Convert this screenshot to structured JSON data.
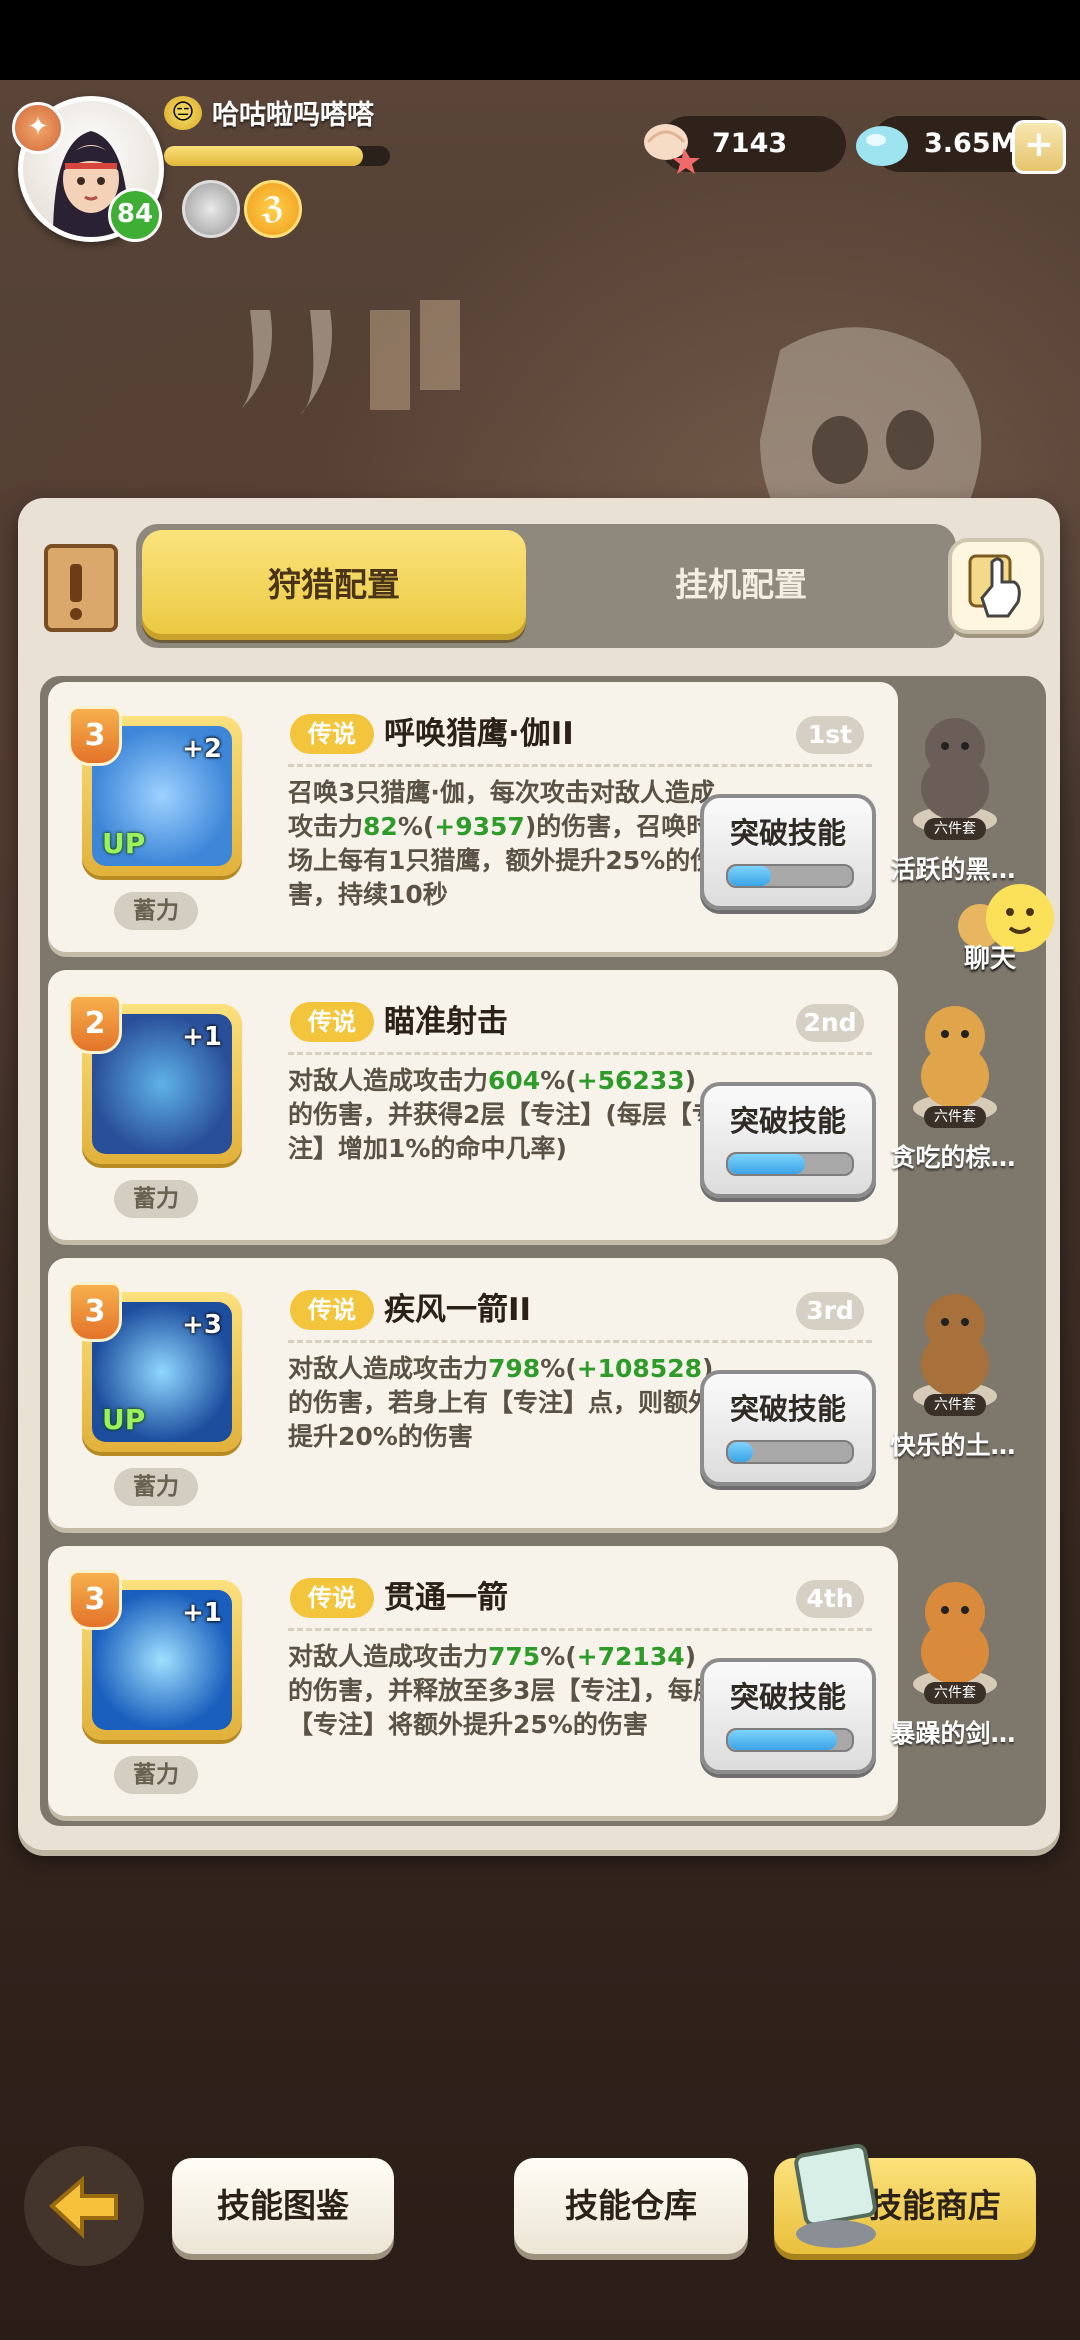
{
  "player": {
    "name": "哈咕啦吗嗒嗒",
    "level": "84",
    "xp_fraction": 0.88
  },
  "currencies": {
    "shells": "7143",
    "crystals": "3.65M",
    "plus": "+"
  },
  "tabs": {
    "hunting": "狩猎配置",
    "idle": "挂机配置"
  },
  "skills": [
    {
      "level": "3",
      "plus": "+2",
      "up": "UP",
      "charge": "蓄力",
      "rarity": "传说",
      "name": "呼唤猎鹰·伽II",
      "rank": "1st",
      "desc_parts": [
        "召唤3只猎鹰·伽，每次攻击对敌人造成攻击力",
        "82",
        "%(",
        "+9357",
        ")的伤害，召唤时场上每有1只猎鹰，额外提升25%的伤害，持续10秒"
      ],
      "button": "突破技能",
      "progress": 0.35
    },
    {
      "level": "2",
      "plus": "+1",
      "up": "",
      "charge": "蓄力",
      "rarity": "传说",
      "name": "瞄准射击",
      "rank": "2nd",
      "desc_parts": [
        "对敌人造成攻击力",
        "604",
        "%(",
        "+56233",
        ")的伤害，并获得2层【专注】(每层【专注】增加1%的命中几率)"
      ],
      "button": "突破技能",
      "progress": 0.62
    },
    {
      "level": "3",
      "plus": "+3",
      "up": "UP",
      "charge": "蓄力",
      "rarity": "传说",
      "name": "疾风一箭II",
      "rank": "3rd",
      "desc_parts": [
        "对敌人造成攻击力",
        "798",
        "%(",
        "+108528",
        ")的伤害，若身上有【专注】点，则额外提升20%的伤害"
      ],
      "button": "突破技能",
      "progress": 0.2
    },
    {
      "level": "3",
      "plus": "+1",
      "up": "",
      "charge": "蓄力",
      "rarity": "传说",
      "name": "贯通一箭",
      "rank": "4th",
      "desc_parts": [
        "对敌人造成攻击力",
        "775",
        "%(",
        "+72134",
        ")的伤害，并释放至多3层【专注】，每层【专注】将额外提升25%的伤害"
      ],
      "button": "突破技能",
      "progress": 0.88
    }
  ],
  "pets": [
    {
      "name": "活跃的黑…",
      "tag": "六件套"
    },
    {
      "name": "贪吃的棕…",
      "tag": "六件套"
    },
    {
      "name": "快乐的土…",
      "tag": "六件套"
    },
    {
      "name": "暴躁的剑…",
      "tag": "六件套"
    }
  ],
  "chat": {
    "label": "聊天"
  },
  "bottom": {
    "codex": "技能图鉴",
    "warehouse": "技能仓库",
    "shop": "技能商店"
  },
  "colors": {
    "accent_yellow": "#f3c53c",
    "highlight_green": "#2e9b2a",
    "progress_blue": "#3aa4e6"
  }
}
